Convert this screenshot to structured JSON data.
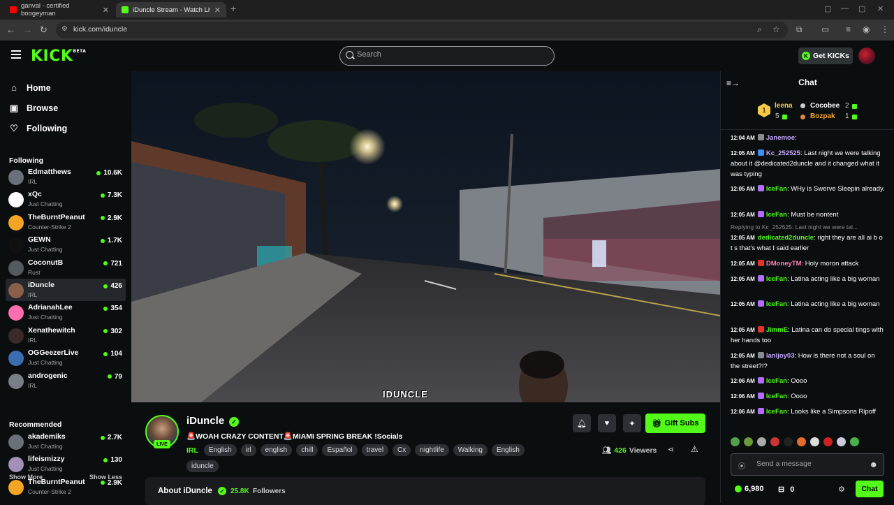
{
  "browser": {
    "tabs": [
      {
        "title": "ganval - certified boogeyman"
      },
      {
        "title": "iDuncle Stream - Watch Live"
      }
    ],
    "url": "kick.com/iduncle"
  },
  "header": {
    "logo": "KICK",
    "beta": "BETA",
    "search_placeholder": "Search",
    "get_kicks": "Get KICKs"
  },
  "sidebar": {
    "nav": [
      {
        "label": "Home",
        "icon": "home-icon"
      },
      {
        "label": "Browse",
        "icon": "browse-icon"
      },
      {
        "label": "Following",
        "icon": "heart-icon"
      }
    ],
    "following_title": "Following",
    "following": [
      {
        "name": "Edmatthews",
        "category": "IRL",
        "viewers": "10.6K",
        "color": "#6a6f7a"
      },
      {
        "name": "xQc",
        "category": "Just Chatting",
        "viewers": "7.3K",
        "color": "#ffffff"
      },
      {
        "name": "TheBurntPeanut",
        "category": "Counter-Strike 2",
        "viewers": "2.9K",
        "color": "#f5a524"
      },
      {
        "name": "GEWN",
        "category": "Just Chatting",
        "viewers": "1.7K",
        "color": "#111111"
      },
      {
        "name": "CoconutB",
        "category": "Rust",
        "viewers": "721",
        "color": "#555a5e"
      },
      {
        "name": "iDuncle",
        "category": "IRL",
        "viewers": "426",
        "color": "#8a5f4a"
      },
      {
        "name": "AdrianahLee",
        "category": "Just Chatting",
        "viewers": "354",
        "color": "#ff6fb0"
      },
      {
        "name": "Xenathewitch",
        "category": "IRL",
        "viewers": "302",
        "color": "#3a2a2a"
      },
      {
        "name": "OGGeezerLive",
        "category": "Just Chatting",
        "viewers": "104",
        "color": "#3c6db0"
      },
      {
        "name": "androgenic",
        "category": "IRL",
        "viewers": "79",
        "color": "#7a7f85"
      }
    ],
    "show_more": "Show More",
    "show_less": "Show Less",
    "recommended_title": "Recommended",
    "recommended": [
      {
        "name": "akademiks",
        "category": "Just Chatting",
        "viewers": "2.7K",
        "color": "#6b7078"
      },
      {
        "name": "lifeismizzy",
        "category": "Just Chatting",
        "viewers": "130",
        "color": "#a38fb8"
      },
      {
        "name": "TheBurntPeanut",
        "category": "Counter-Strike 2",
        "viewers": "2.9K",
        "color": "#f5a524"
      }
    ]
  },
  "video": {
    "overlay_text": "IDUNCLE"
  },
  "stream": {
    "streamer": "iDuncle",
    "live": "LIVE",
    "title": "🚨WOAH CRAZY CONTENT🚨MIAMI SPRING BREAK !Socials",
    "category": "IRL",
    "tags": [
      "English",
      "irl",
      "english",
      "chill",
      "Español",
      "travel",
      "Cx",
      "nightlife",
      "Walking",
      "English",
      "iduncle"
    ],
    "gift_subs": "Gift Subs",
    "viewer_count": "426",
    "viewers_label": "Viewers",
    "about_title": "About iDuncle",
    "followers_count": "25.8K",
    "followers_label": "Followers"
  },
  "chat": {
    "title": "Chat",
    "leaderboard": {
      "first": {
        "rank": "1",
        "name": "leena",
        "count": "5"
      },
      "second": {
        "name": "Cocobee",
        "count": "2"
      },
      "third": {
        "name": "Bozpak",
        "count": "1"
      }
    },
    "messages": [
      {
        "time": "12:04 AM",
        "user": "Janemoe",
        "color": "#c6a7ff",
        "badge": "#8a8d90",
        "text": ""
      },
      {
        "time": "12:05 AM",
        "user": "Kc_252525",
        "color": "#c6a7ff",
        "badge": "#3f8ff7",
        "text": "Last night we were talking about it @dedicated2duncle and it changed what it was typing"
      },
      {
        "time": "12:05 AM",
        "user": "IceFan",
        "color": "#53fc18",
        "badge": "#b46cff",
        "text": "WHy is Swerve Sleepin already."
      },
      {
        "time": "12:05 AM",
        "user": "IceFan",
        "color": "#53fc18",
        "badge": "#b46cff",
        "text": "Must be nontent"
      },
      {
        "time": "12:05 AM",
        "user": "dedicated2duncle",
        "color": "#53fc18",
        "badge": "",
        "text": "right they are all ai b o t s that's what I said earlier",
        "reply": "Replying to Kc_252525: Last night we were tal..."
      },
      {
        "time": "12:05 AM",
        "user": "DMoneyTM",
        "color": "#ff7eb6",
        "badge": "#e5322d",
        "text": "Holy moron attack"
      },
      {
        "time": "12:05 AM",
        "user": "IceFan",
        "color": "#53fc18",
        "badge": "#b46cff",
        "text": "Latina acting like a big woman"
      },
      {
        "time": "12:05 AM",
        "user": "IceFan",
        "color": "#53fc18",
        "badge": "#b46cff",
        "text": "Latina acting like a big woman"
      },
      {
        "time": "12:05 AM",
        "user": "JimmE",
        "color": "#53fc18",
        "badge": "#e5322d",
        "text": "Latina can do special tings with her hands too"
      },
      {
        "time": "12:05 AM",
        "user": "lanijoy03",
        "color": "#c6a7ff",
        "badge": "#8a8d90",
        "text": "How is there not a soul on the street?!?"
      },
      {
        "time": "12:06 AM",
        "user": "IceFan",
        "color": "#53fc18",
        "badge": "#b46cff",
        "text": "Oooo"
      },
      {
        "time": "12:06 AM",
        "user": "IceFan",
        "color": "#53fc18",
        "badge": "#b46cff",
        "text": "Oooo"
      },
      {
        "time": "12:06 AM",
        "user": "IceFan",
        "color": "#53fc18",
        "badge": "#b46cff",
        "text": "Looks like a Simpsons Ripoff"
      }
    ],
    "input_placeholder": "Send a message",
    "kicks_balance": "6,980",
    "chest_count": "0",
    "send_label": "Chat"
  },
  "colors": {
    "accent": "#53fc18",
    "background": "#0b0e0f"
  }
}
